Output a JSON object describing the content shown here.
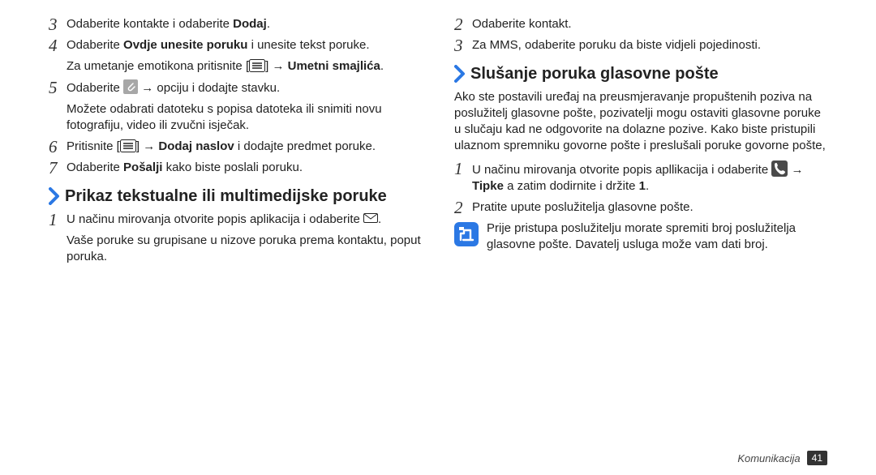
{
  "left": {
    "steps": [
      {
        "num": "3",
        "p1a": "Odaberite kontakte i odaberite ",
        "p1b": "Dodaj",
        "p1c": "."
      },
      {
        "num": "4",
        "p1a": "Odaberite ",
        "p1b": "Ovdje unesite poruku",
        "p1c": " i unesite tekst poruke.",
        "p2a": "Za umetanje emotikona pritisnite [",
        "p2b": "] → ",
        "p2c": "Umetni smajlića",
        "p2d": "."
      },
      {
        "num": "5",
        "p1a": "Odaberite ",
        "p1b": " → opciju i dodajte stavku.",
        "p2": "Možete odabrati datoteku s popisa datoteka ili snimiti novu fotografiju, video ili zvučni isječak."
      },
      {
        "num": "6",
        "p1a": "Pritisnite [",
        "p1b": "] → ",
        "p1c": "Dodaj naslov",
        "p1d": " i dodajte predmet poruke."
      },
      {
        "num": "7",
        "p1a": "Odaberite ",
        "p1b": "Pošalji",
        "p1c": " kako biste poslali poruku."
      }
    ],
    "heading": "Prikaz tekstualne ili multimedijske poruke",
    "after": [
      {
        "num": "1",
        "p1": "U načinu mirovanja otvorite popis aplikacija i odaberite ",
        "p2": "Vaše poruke su grupisane u nizove poruka prema kontaktu, poput poruka."
      }
    ]
  },
  "right": {
    "steps": [
      {
        "num": "2",
        "p1": "Odaberite kontakt."
      },
      {
        "num": "3",
        "p1": "Za MMS, odaberite poruku da biste vidjeli pojedinosti."
      }
    ],
    "heading": "Slušanje poruka glasovne pošte",
    "para": "Ako ste postavili uređaj na preusmjeravanje propuštenih poziva na poslužitelj glasovne pošte, pozivatelji mogu ostaviti glasovne poruke u slučaju kad ne odgovorite na dolazne pozive. Kako biste pristupili ulaznom spremniku govorne pošte i preslušali poruke govorne pošte,",
    "steps2": [
      {
        "num": "1",
        "p1a": "U načinu mirovanja otvorite popis apllikacija i odaberite ",
        "p1b": " → ",
        "p1c": "Tipke",
        "p1d": " a zatim dodirnite i držite ",
        "p1e": "1",
        "p1f": "."
      },
      {
        "num": "2",
        "p1": "Pratite upute poslužitelja glasovne pošte."
      }
    ],
    "note": "Prije pristupa poslužitelju morate spremiti broj poslužitelja glasovne pošte. Davatelj usluga može vam dati broj."
  },
  "footer": {
    "section": "Komunikacija",
    "page": "41"
  }
}
